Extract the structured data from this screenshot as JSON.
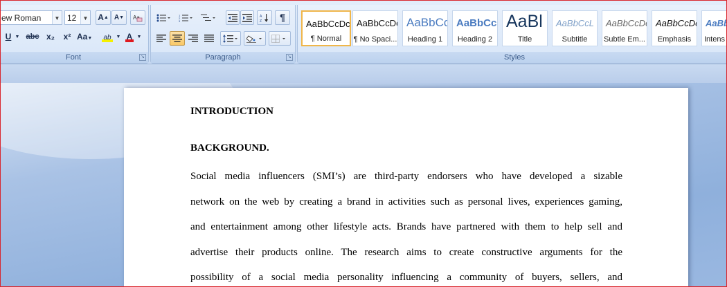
{
  "ribbon": {
    "font_group": {
      "label": "Font",
      "font_name": "ew Roman",
      "font_size": "12",
      "grow_font": "A",
      "shrink_font": "A",
      "underline": "U",
      "strikethrough": "abc",
      "subscript": "x₂",
      "superscript": "x²",
      "change_case": "Aa",
      "highlight": "ab",
      "font_color": "A",
      "highlight_color": "#f5f000",
      "font_color_value": "#e0191f"
    },
    "paragraph_group": {
      "label": "Paragraph",
      "show_marks": "¶"
    },
    "styles_group": {
      "label": "Styles",
      "items": [
        {
          "preview": "AaBbCcDc",
          "name": "¶ Normal"
        },
        {
          "preview": "AaBbCcDc",
          "name": "¶ No Spaci..."
        },
        {
          "preview": "AaBbCc",
          "name": "Heading 1"
        },
        {
          "preview": "AaBbCc",
          "name": "Heading 2"
        },
        {
          "preview": "AaBl",
          "name": "Title"
        },
        {
          "preview": "AaBbCcL",
          "name": "Subtitle"
        },
        {
          "preview": "AaBbCcDc",
          "name": "Subtle Em..."
        },
        {
          "preview": "AaBbCcDc",
          "name": "Emphasis"
        },
        {
          "preview": "AaBb",
          "name": "Intens"
        }
      ]
    }
  },
  "document": {
    "heading1": "INTRODUCTION",
    "heading2": "BACKGROUND.",
    "paragraph_lines": [
      "Social media influencers (SMI’s) are third-party endorsers who have developed a sizable",
      "network on the web by creating a brand in activities such as personal lives, experiences gaming,",
      "and entertainment among other lifestyle acts.  Brands have partnered with them to help sell and",
      "advertise their products online. The research aims to create constructive arguments for the",
      "possibility of a social media personality influencing a community of buyers, sellers, and"
    ]
  }
}
